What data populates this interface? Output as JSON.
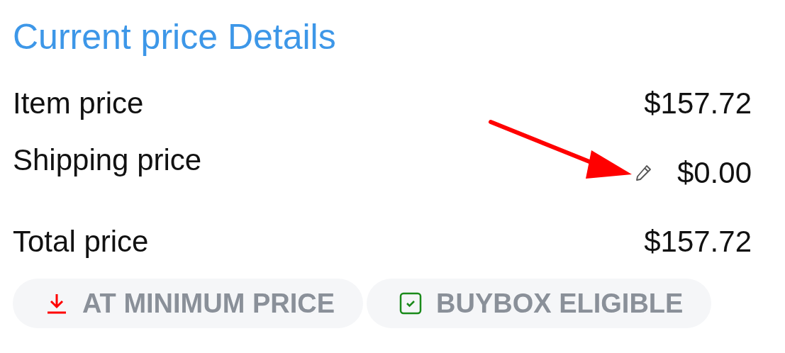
{
  "title": "Current price Details",
  "rows": [
    {
      "label": "Item price",
      "value": "$157.72",
      "editable": false
    },
    {
      "label": "Shipping price",
      "value": "$0.00",
      "editable": true
    },
    {
      "label": "Total price",
      "value": "$157.72",
      "editable": false
    }
  ],
  "badges": [
    {
      "kind": "minimum",
      "label": "AT MINIMUM PRICE"
    },
    {
      "kind": "buybox",
      "label": "BUYBOX ELIGIBLE"
    }
  ],
  "annotation": {
    "kind": "arrow"
  }
}
